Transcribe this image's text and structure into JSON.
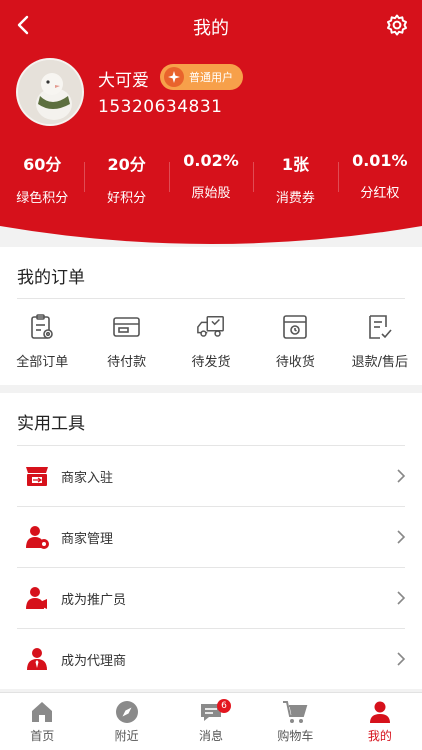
{
  "header": {
    "title": "我的"
  },
  "user": {
    "name": "大可爱",
    "level": "普通用户",
    "phone": "15320634831"
  },
  "stats": [
    {
      "value": "60分",
      "label": "绿色积分"
    },
    {
      "value": "20分",
      "label": "好积分"
    },
    {
      "value": "0.02%",
      "label": "原始股"
    },
    {
      "value": "1张",
      "label": "消费券"
    },
    {
      "value": "0.01%",
      "label": "分红权"
    }
  ],
  "orders": {
    "title": "我的订单",
    "items": [
      {
        "label": "全部订单",
        "icon": "clipboard-icon"
      },
      {
        "label": "待付款",
        "icon": "wallet-icon"
      },
      {
        "label": "待发货",
        "icon": "truck-icon"
      },
      {
        "label": "待收货",
        "icon": "package-icon"
      },
      {
        "label": "退款/售后",
        "icon": "refund-icon"
      }
    ]
  },
  "tools": {
    "title": "实用工具",
    "items": [
      {
        "label": "商家入驻",
        "icon": "store-icon"
      },
      {
        "label": "商家管理",
        "icon": "merchant-manage-icon"
      },
      {
        "label": "成为推广员",
        "icon": "promoter-icon"
      },
      {
        "label": "成为代理商",
        "icon": "agent-icon"
      }
    ]
  },
  "tabbar": {
    "items": [
      {
        "label": "首页",
        "icon": "home-icon"
      },
      {
        "label": "附近",
        "icon": "compass-icon"
      },
      {
        "label": "消息",
        "icon": "message-icon",
        "badge": "6"
      },
      {
        "label": "购物车",
        "icon": "cart-icon"
      },
      {
        "label": "我的",
        "icon": "user-icon",
        "active": true
      }
    ]
  },
  "colors": {
    "brand": "#d6111b",
    "badge": "#f7a04a",
    "accent_gray": "#8a8a8a"
  }
}
